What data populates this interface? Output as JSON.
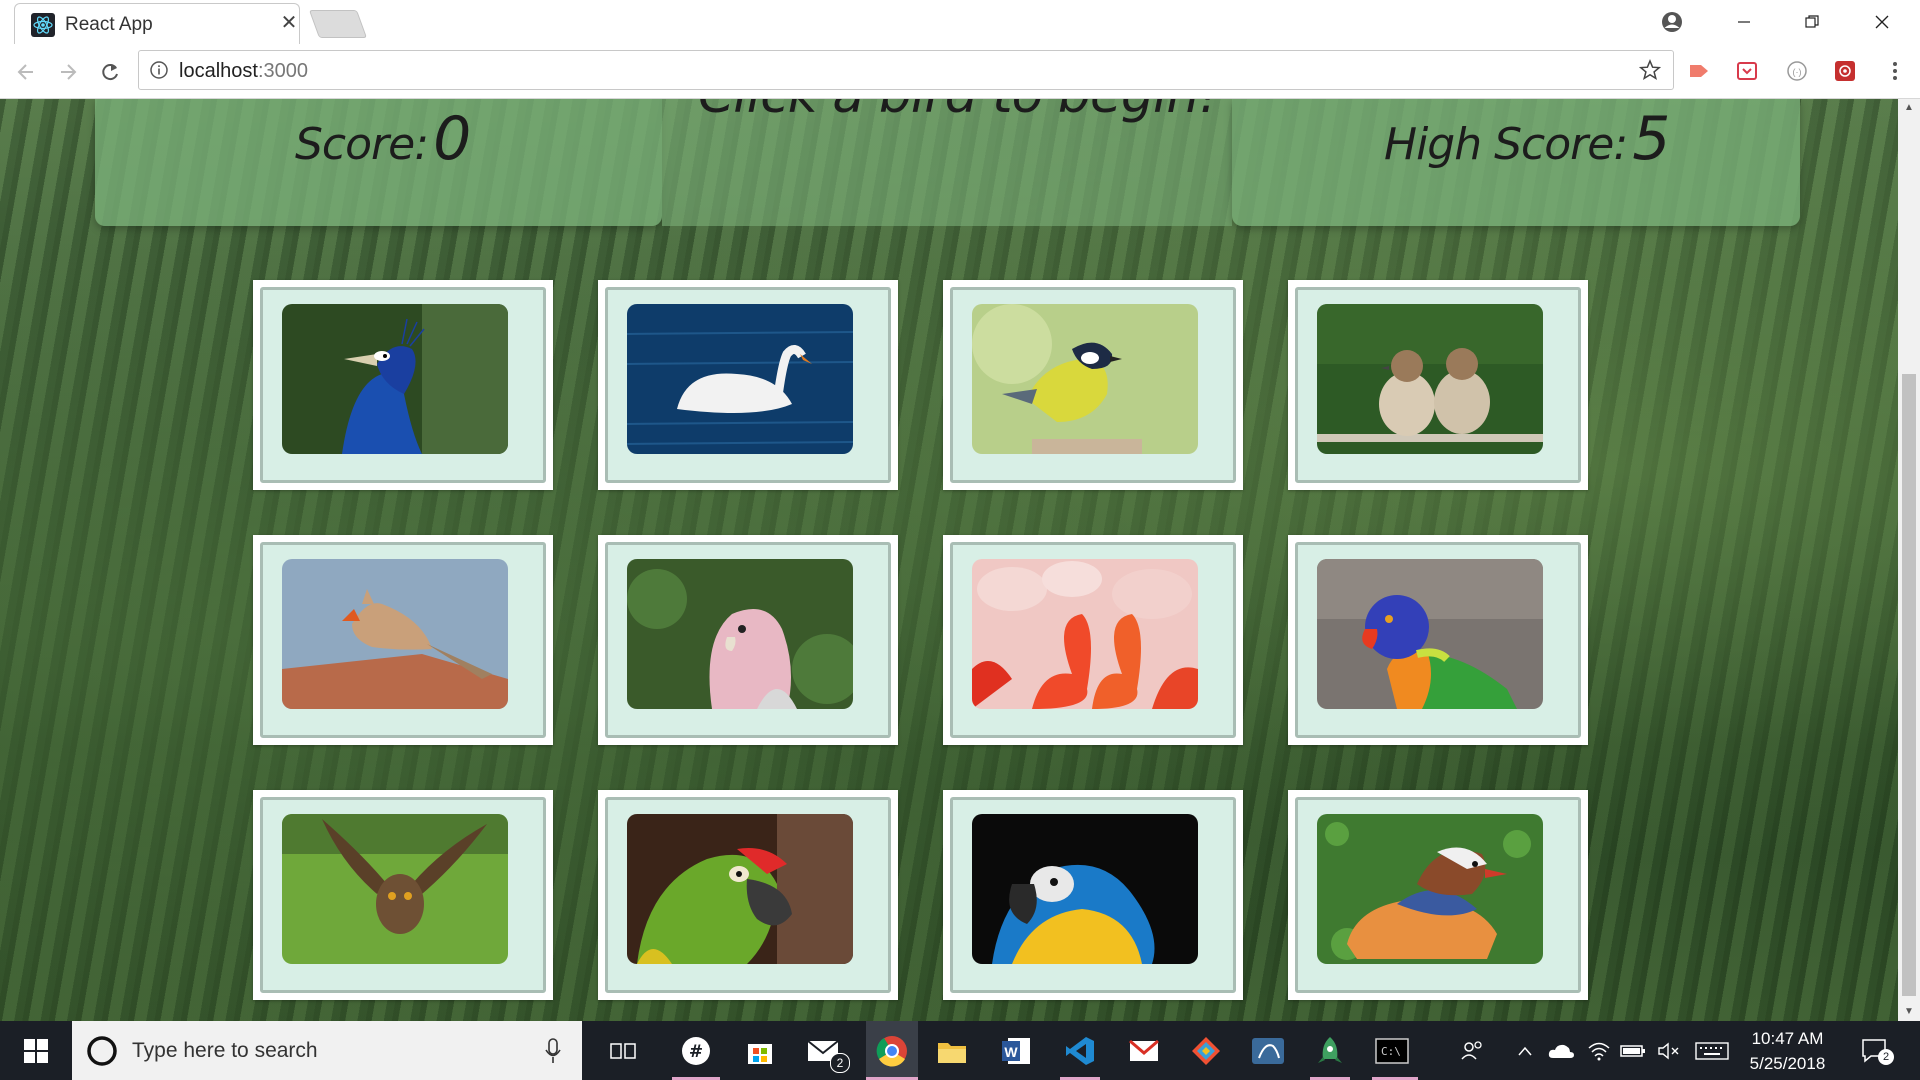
{
  "browser": {
    "tab_title": "React App",
    "tab_close": "✕",
    "url_host": "localhost",
    "url_port": ":3000"
  },
  "game": {
    "score_label": "Score:",
    "score_value": "0",
    "message": "Click a bird to begin!",
    "high_score_label": "High Score:",
    "high_score_value": "5",
    "cards": [
      {
        "bird": "peacock"
      },
      {
        "bird": "swan"
      },
      {
        "bird": "great tit"
      },
      {
        "bird": "sparrows"
      },
      {
        "bird": "cardinal"
      },
      {
        "bird": "galah cockatoo"
      },
      {
        "bird": "flamingos"
      },
      {
        "bird": "rainbow lorikeet"
      },
      {
        "bird": "owl"
      },
      {
        "bird": "green macaw"
      },
      {
        "bird": "blue-and-yellow macaw"
      },
      {
        "bird": "mandarin duck"
      }
    ]
  },
  "taskbar": {
    "search_placeholder": "Type here to search",
    "mail_badge": "2",
    "time": "10:47 AM",
    "date": "5/25/2018",
    "notification_count": "2"
  },
  "colors": {
    "header_panel": "#7aaf78",
    "card_inner": "#d8efe6",
    "taskbar": "#1b1f26"
  }
}
